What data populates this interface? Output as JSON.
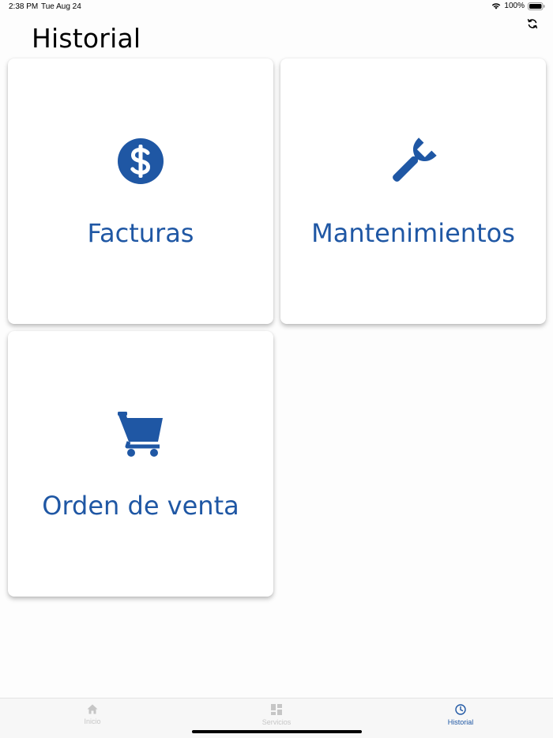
{
  "status_bar": {
    "time": "2:38 PM",
    "date": "Tue Aug 24",
    "battery": "100%"
  },
  "header": {
    "title": "Historial",
    "refresh_icon": "refresh-icon"
  },
  "cards": [
    {
      "label": "Facturas",
      "icon": "dollar-circle-icon"
    },
    {
      "label": "Mantenimientos",
      "icon": "wrench-icon"
    },
    {
      "label": "Orden de venta",
      "icon": "shopping-cart-icon"
    }
  ],
  "tab_bar": {
    "items": [
      {
        "label": "Inicio",
        "icon": "home-icon",
        "active": false
      },
      {
        "label": "Servicios",
        "icon": "grid-icon",
        "active": false
      },
      {
        "label": "Historial",
        "icon": "clock-icon",
        "active": true
      }
    ]
  },
  "colors": {
    "accent": "#1f57a4",
    "inactive": "#c6c6c6",
    "background": "#fdfdfd",
    "card": "#ffffff"
  }
}
